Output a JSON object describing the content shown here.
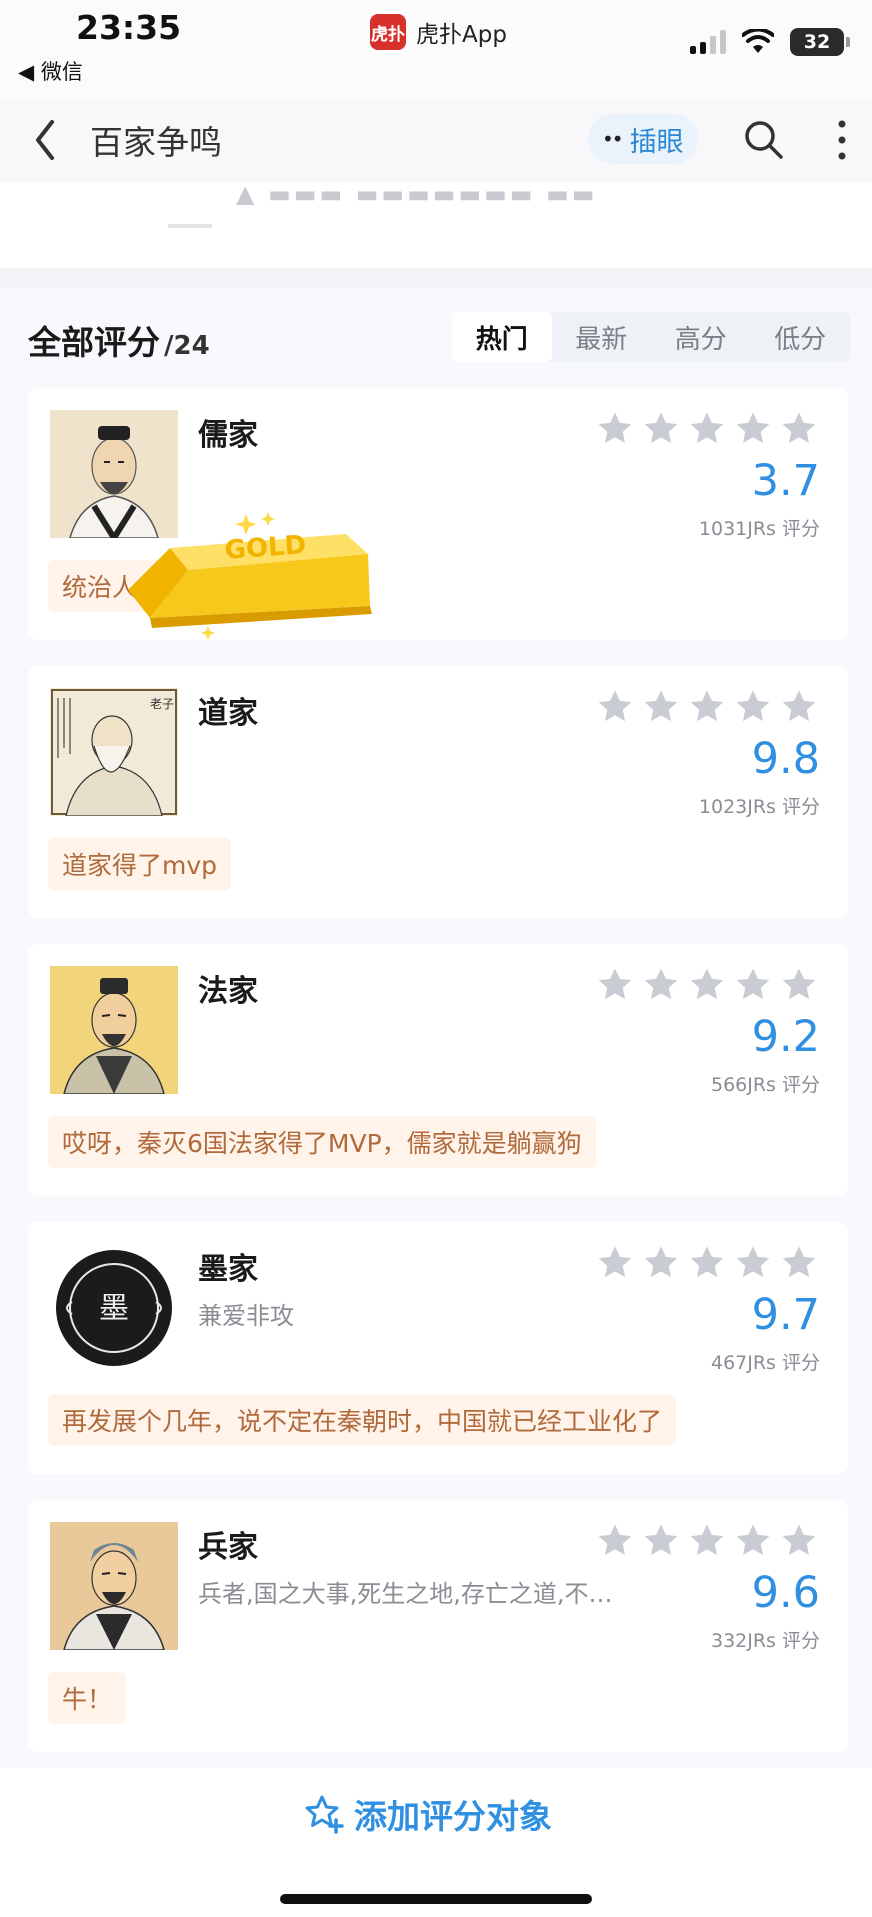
{
  "status": {
    "time": "23:35",
    "back_app": "◀ 微信",
    "app_name": "虎扑App",
    "app_logo_text": "虎扑",
    "battery": "32"
  },
  "nav": {
    "title": "百家争鸣",
    "peek_label": "插眼",
    "peek_eyes": "••"
  },
  "list": {
    "title": "全部评分",
    "count": "/24",
    "tabs": [
      "热门",
      "最新",
      "高分",
      "低分"
    ],
    "active_tab": "热门"
  },
  "items": [
    {
      "name": "儒家",
      "desc": "",
      "score": "3.7",
      "raters": "1031JRs 评分",
      "comment": "统治人…的工具"
    },
    {
      "name": "道家",
      "desc": "",
      "score": "9.8",
      "raters": "1023JRs 评分",
      "comment": "道家得了mvp"
    },
    {
      "name": "法家",
      "desc": "",
      "score": "9.2",
      "raters": "566JRs 评分",
      "comment": "哎呀，秦灭6国法家得了MVP，儒家就是躺赢狗"
    },
    {
      "name": "墨家",
      "desc": "兼爱非攻",
      "score": "9.7",
      "raters": "467JRs 评分",
      "comment": "再发展个几年，说不定在秦朝时，中国就已经工业化了"
    },
    {
      "name": "兵家",
      "desc": "兵者,国之大事,死生之地,存亡之道,不…",
      "score": "9.6",
      "raters": "332JRs 评分",
      "comment": "牛！"
    }
  ],
  "sticker": {
    "text": "GOLD"
  },
  "bottom": {
    "add_label": "添加评分对象"
  },
  "colors": {
    "accent": "#2f8fe0",
    "star": "#c9ccd2",
    "comment_bg": "#fff3ea",
    "comment_text": "#b06a3c",
    "gold": "#f5c219"
  }
}
